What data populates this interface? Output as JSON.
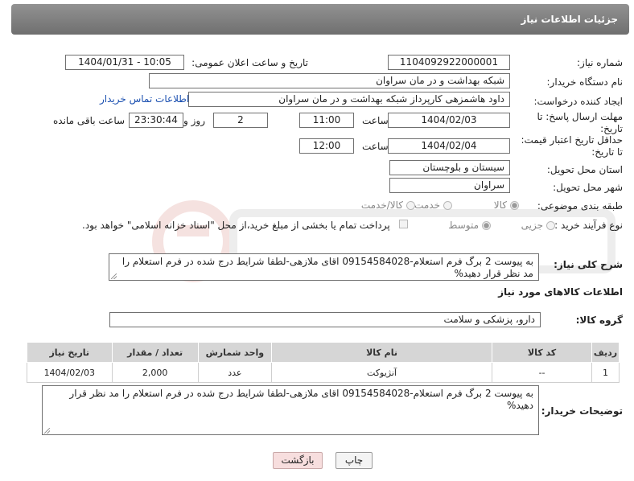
{
  "header": {
    "title": "جزئیات اطلاعات نیاز"
  },
  "form": {
    "need_number": {
      "label": "شماره نیاز:",
      "value": "1104092922000001"
    },
    "announce_datetime": {
      "label": "تاریخ و ساعت اعلان عمومی:",
      "value": "1404/01/31 - 10:05"
    },
    "buyer_org": {
      "label": "نام دستگاه خریدار:",
      "value": "شبکه بهداشت و در مان سراوان"
    },
    "requester": {
      "label": "ایجاد کننده درخواست:",
      "value": "داود هاشمزهی  کارپرداز شبکه بهداشت و در مان سراوان",
      "contact_link": "اطلاعات تماس خریدار"
    },
    "reply_deadline": {
      "label_line1": "مهلت ارسال پاسخ: تا",
      "label_line2": "تاریخ:",
      "date": "1404/02/03",
      "time_label": "ساعت",
      "time": "11:00",
      "days": "2",
      "days_label": "روز و",
      "remaining": "23:30:44",
      "remaining_label": "ساعت باقی مانده"
    },
    "price_validity": {
      "label_line1": "حداقل تاریخ اعتبار قیمت:",
      "label_line2": "تا تاریخ:",
      "date": "1404/02/04",
      "time_label": "ساعت",
      "time": "12:00"
    },
    "province": {
      "label": "استان محل تحویل:",
      "value": "سیستان و بلوچستان"
    },
    "city": {
      "label": "شهر محل تحویل:",
      "value": "سراوان"
    },
    "category": {
      "label": "طبقه بندی موضوعی:",
      "options": [
        "کالا",
        "خدمت",
        "کالا/خدمت"
      ],
      "selected": "کالا"
    },
    "purchase_type": {
      "label": "نوع فرآیند خرید :",
      "options": [
        "جزیی",
        "متوسط"
      ],
      "selected": "متوسط",
      "payment_note": "پرداخت تمام یا بخشی از مبلغ خرید،از محل \"اسناد خزانه اسلامی\" خواهد بود."
    },
    "description": {
      "label": "شرح کلی نیاز:",
      "value": "به پیوست 2 برگ فرم استعلام-09154584028 اقای ملازهی-لطفا شرایط درج شده در فرم استعلام را مد نظر قرار دهید%"
    }
  },
  "goods": {
    "section_title": "اطلاعات کالاهای مورد نیاز",
    "group_label": "گروه کالا:",
    "group_value": "دارو، پزشکی و سلامت",
    "columns": [
      "ردیف",
      "کد کالا",
      "نام کالا",
      "واحد شمارش",
      "تعداد / مقدار",
      "تاریخ نیاز"
    ],
    "rows": [
      [
        "1",
        "--",
        "آنژیوکت",
        "عدد",
        "2,000",
        "1404/02/03"
      ]
    ]
  },
  "buyer_notes": {
    "label": "توضیحات خریدار:",
    "value": "به پیوست 2 برگ فرم استعلام-09154584028 اقای ملازهی-لطفا شرایط درج شده در فرم استعلام را مد نظر قرار دهید%"
  },
  "buttons": {
    "print": "چاپ",
    "back": "بازگشت"
  },
  "colors": {
    "header": "#7f7f7f",
    "link": "#1a4fb0",
    "back_button": "#f7dede",
    "table_header": "#d6d6d6"
  }
}
